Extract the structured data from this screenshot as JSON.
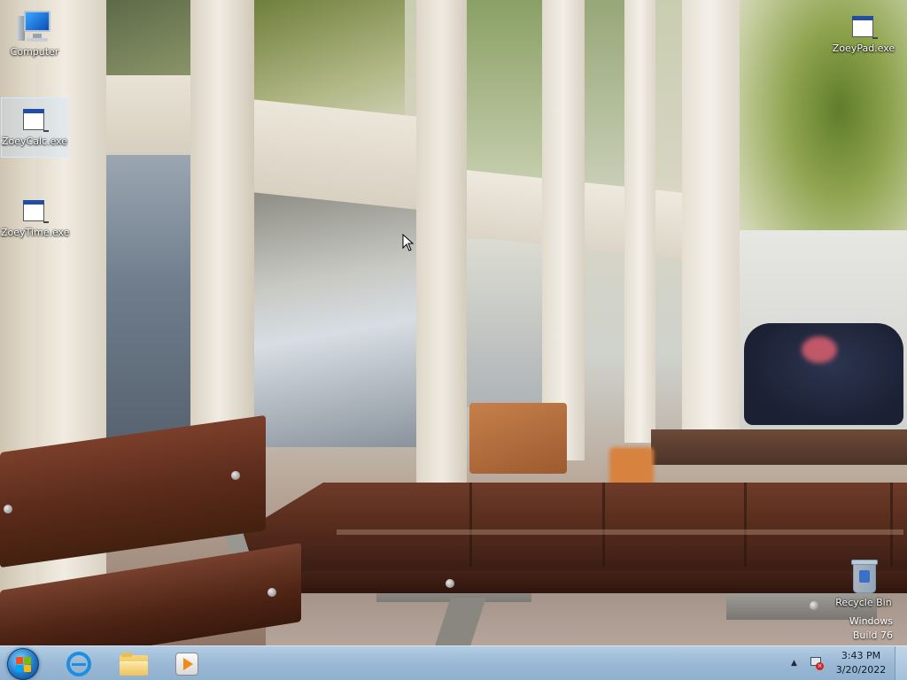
{
  "desktop": {
    "icons": [
      {
        "label": "Computer",
        "icon": "computer-icon"
      },
      {
        "label": "ZoeyCalc.exe",
        "icon": "exe-file-icon",
        "selected": true
      },
      {
        "label": "ZoeyTime.exe",
        "icon": "exe-file-icon"
      },
      {
        "label": "ZoeyPad.exe",
        "icon": "exe-file-icon"
      },
      {
        "label": "Recycle Bin",
        "icon": "recycle-bin-icon"
      }
    ],
    "watermark": {
      "line1": "Windows",
      "line2": "Build 76"
    }
  },
  "taskbar": {
    "start_button": {
      "icon": "windows-start-orb-icon"
    },
    "pinned": [
      {
        "name": "Internet Explorer",
        "icon": "internet-explorer-icon"
      },
      {
        "name": "Windows Explorer",
        "icon": "folder-icon"
      },
      {
        "name": "Media Player",
        "icon": "media-player-icon"
      }
    ],
    "tray": {
      "overflow_icon": "chevron-up-icon",
      "network_icon": "network-disconnected-icon",
      "time": "3:43 PM",
      "date": "3/20/2022"
    }
  },
  "colors": {
    "taskbar_top": "#b4cde4",
    "taskbar_bottom": "#8fb0cf",
    "selection": "#c8e1ff",
    "icon_text": "#ffffff"
  }
}
